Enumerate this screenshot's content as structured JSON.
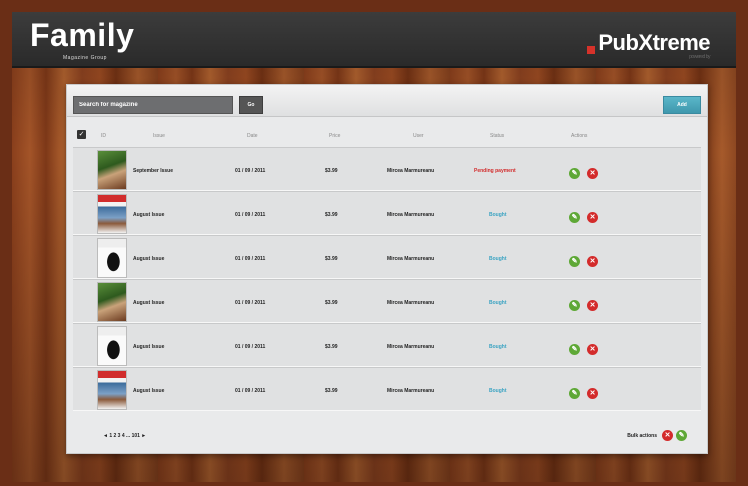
{
  "header": {
    "brand_left": "Family",
    "brand_left_sub": "Magazine Group",
    "brand_right": "PubXtreme",
    "brand_right_tag": "powered by"
  },
  "toolbar": {
    "search_placeholder": "Search for magazine",
    "go_label": "Go",
    "add_label": "Add"
  },
  "table": {
    "columns": [
      "ID",
      "Issue",
      "Date",
      "Price",
      "User",
      "Status",
      "Actions"
    ],
    "rows": [
      {
        "issue": "September Issue",
        "date": "01 / 09 / 2011",
        "price": "$3.99",
        "user": "Mircea Marmureanu",
        "status": "Pending payment",
        "status_type": "pending",
        "cover": "green"
      },
      {
        "issue": "August Issue",
        "date": "01 / 09 / 2011",
        "price": "$3.99",
        "user": "Mircea Marmureanu",
        "status": "Bought",
        "status_type": "bought",
        "cover": "red"
      },
      {
        "issue": "August Issue",
        "date": "01 / 09 / 2011",
        "price": "$3.99",
        "user": "Mircea Marmureanu",
        "status": "Bought",
        "status_type": "bought",
        "cover": "bw"
      },
      {
        "issue": "August Issue",
        "date": "01 / 09 / 2011",
        "price": "$3.99",
        "user": "Mircea Marmureanu",
        "status": "Bought",
        "status_type": "bought",
        "cover": "green"
      },
      {
        "issue": "August Issue",
        "date": "01 / 09 / 2011",
        "price": "$3.99",
        "user": "Mircea Marmureanu",
        "status": "Bought",
        "status_type": "bought",
        "cover": "bw"
      },
      {
        "issue": "August Issue",
        "date": "01 / 09 / 2011",
        "price": "$3.99",
        "user": "Mircea Marmureanu",
        "status": "Bought",
        "status_type": "bought",
        "cover": "red"
      }
    ]
  },
  "pagination": {
    "text": "◄ 1 2 3 4 ... 101 ►"
  },
  "bulk": {
    "label": "Bulk actions"
  },
  "colors": {
    "accent": "#3f98ad",
    "pending": "#d22b2b",
    "bought": "#3aa3c2",
    "approve": "#5ea836",
    "delete": "#d32b2b"
  }
}
